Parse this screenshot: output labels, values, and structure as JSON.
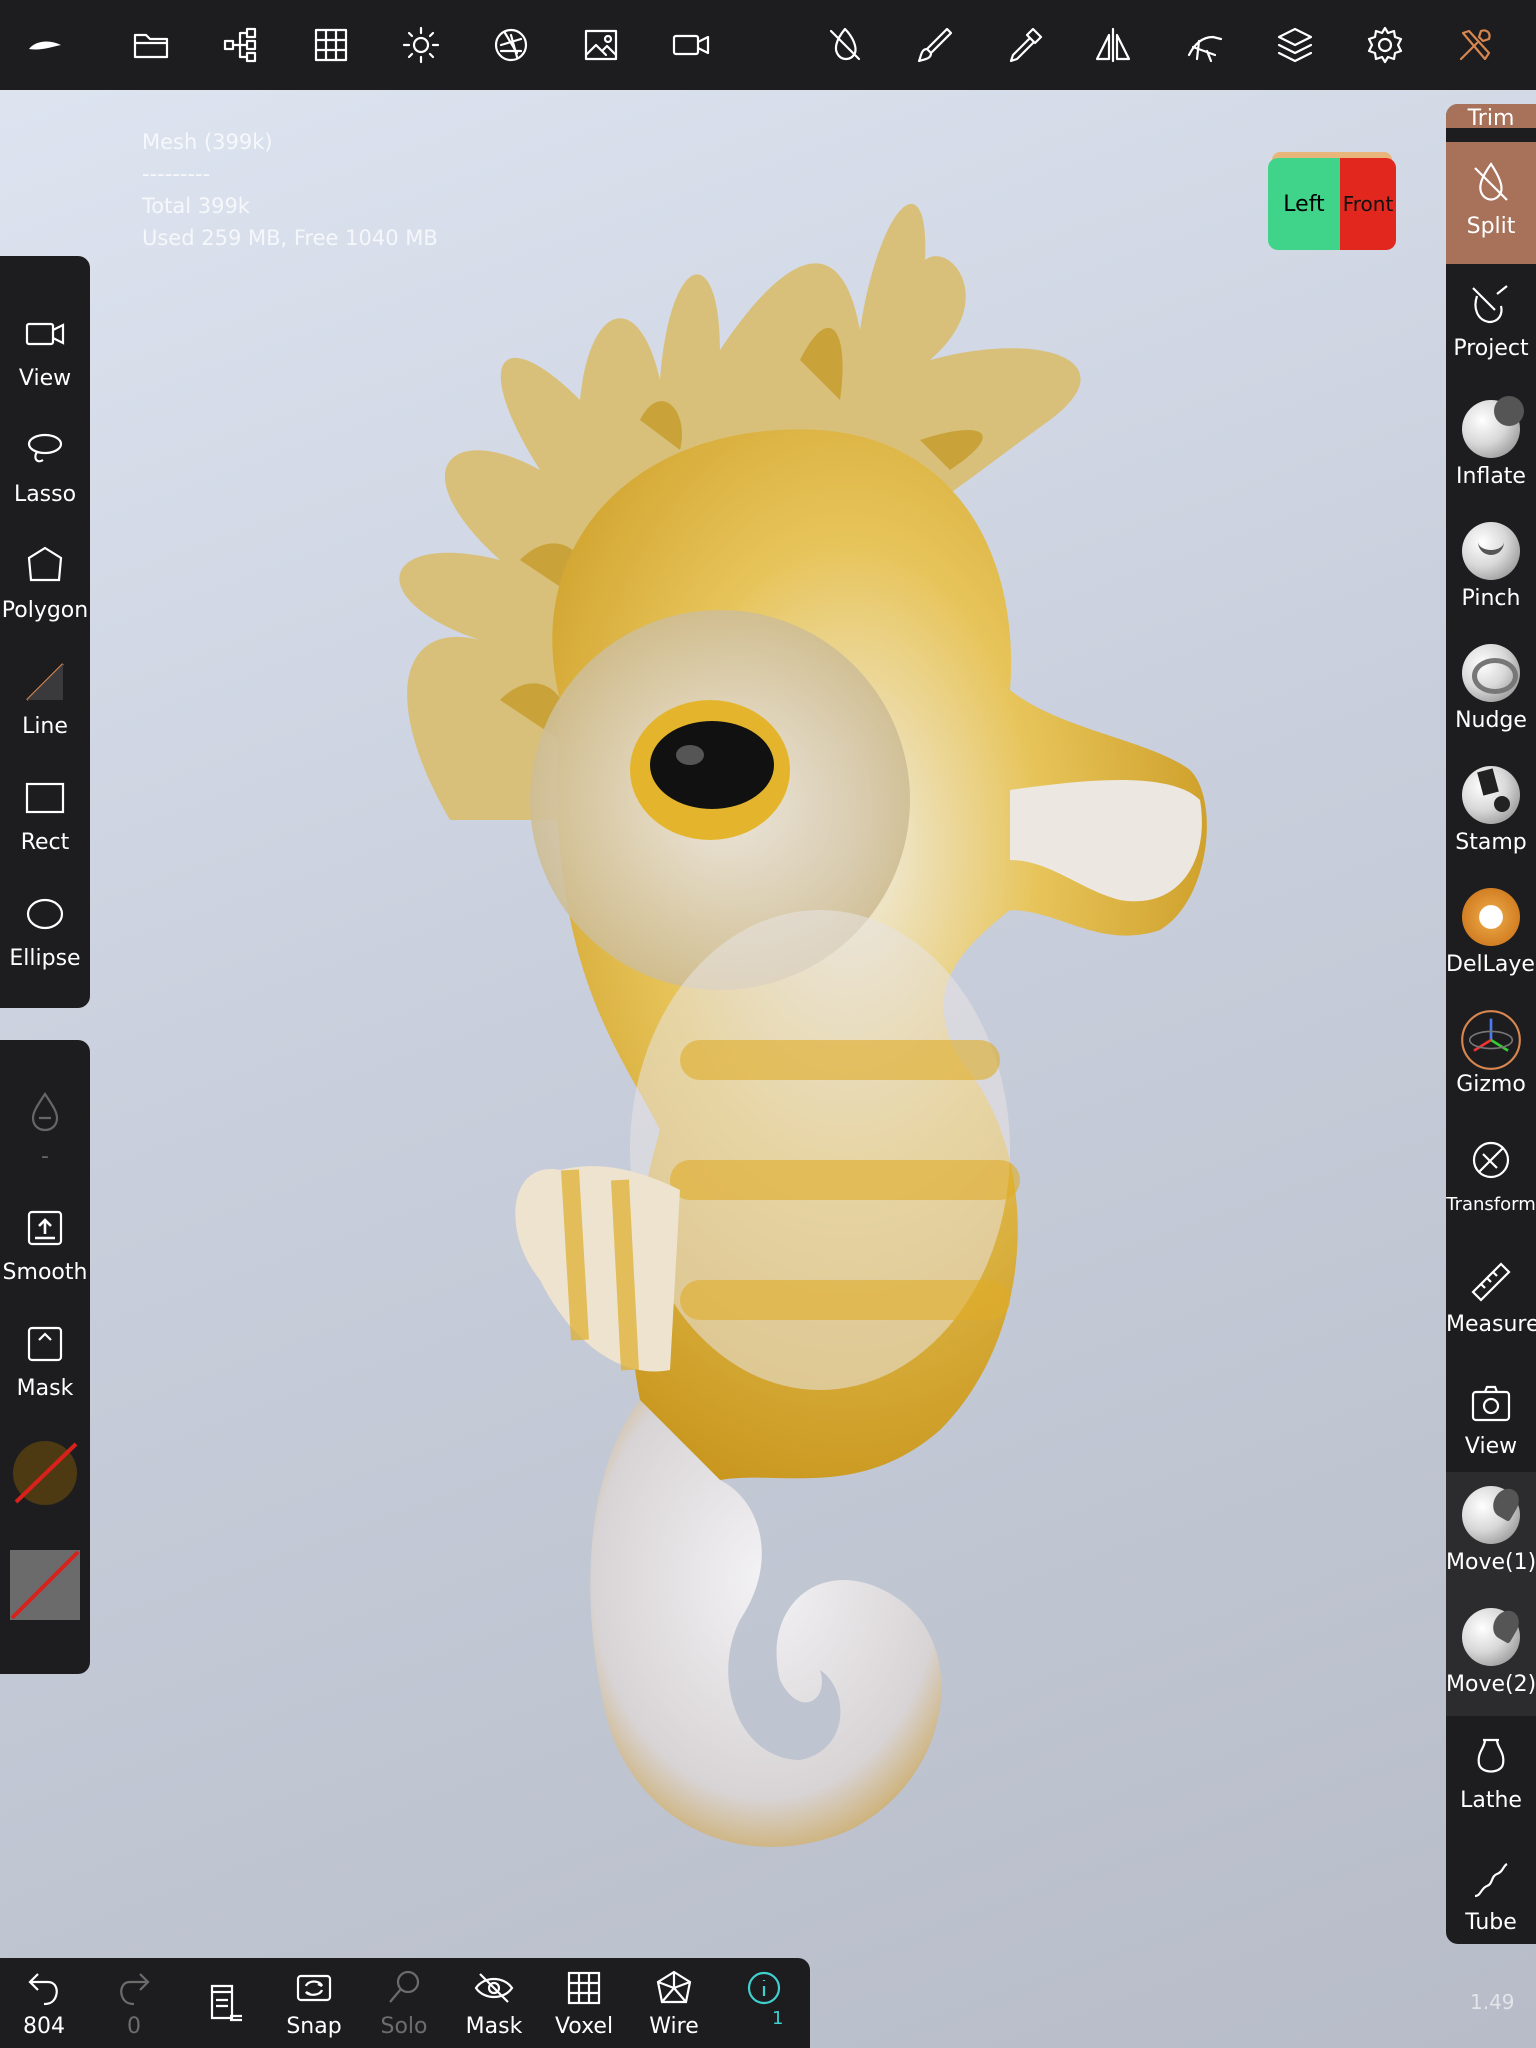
{
  "toolbar_icons": [
    "app-logo-icon",
    "folder-icon",
    "scene-tree-icon",
    "grid-icon",
    "light-icon",
    "aperture-icon",
    "image-icon",
    "video-icon",
    "symmetry-off-icon",
    "brush-icon",
    "eyedropper-icon",
    "mirror-icon",
    "hand-icon",
    "layers-icon",
    "gear-icon",
    "tools-icon"
  ],
  "stats": {
    "mesh": "Mesh (399k)",
    "separator": "---------",
    "total": "Total 399k",
    "memory": "Used 259 MB,  Free 1040 MB"
  },
  "view_cube": {
    "left": "Left",
    "front": "Front"
  },
  "left_tools": {
    "view": "View",
    "lasso": "Lasso",
    "polygon": "Polygon",
    "line": "Line",
    "rect": "Rect",
    "ellipse": "Ellipse"
  },
  "left_options": {
    "drop_value": "-",
    "smooth": "Smooth",
    "mask": "Mask"
  },
  "right_tools": {
    "trim": "Trim",
    "split": "Split",
    "project": "Project",
    "inflate": "Inflate",
    "pinch": "Pinch",
    "nudge": "Nudge",
    "stamp": "Stamp",
    "dellayer": "DelLayer",
    "gizmo": "Gizmo",
    "transform": "Transform",
    "measure": "Measure",
    "view": "View",
    "move1": "Move(1)",
    "move2": "Move(2)",
    "lathe": "Lathe",
    "tube": "Tube"
  },
  "bottom": {
    "undo_count": "804",
    "redo_count": "0",
    "snap": "Snap",
    "solo": "Solo",
    "mask": "Mask",
    "voxel": "Voxel",
    "wire": "Wire",
    "info_count": "1"
  },
  "version": "1.49",
  "colors": {
    "panel": "#1d1d1f",
    "active_tool": "#a8725a",
    "seahorse_yellow": "#e3b128",
    "seahorse_white": "#e8e6ea",
    "cube_left": "#3fd48a",
    "cube_front": "#e2271f"
  }
}
